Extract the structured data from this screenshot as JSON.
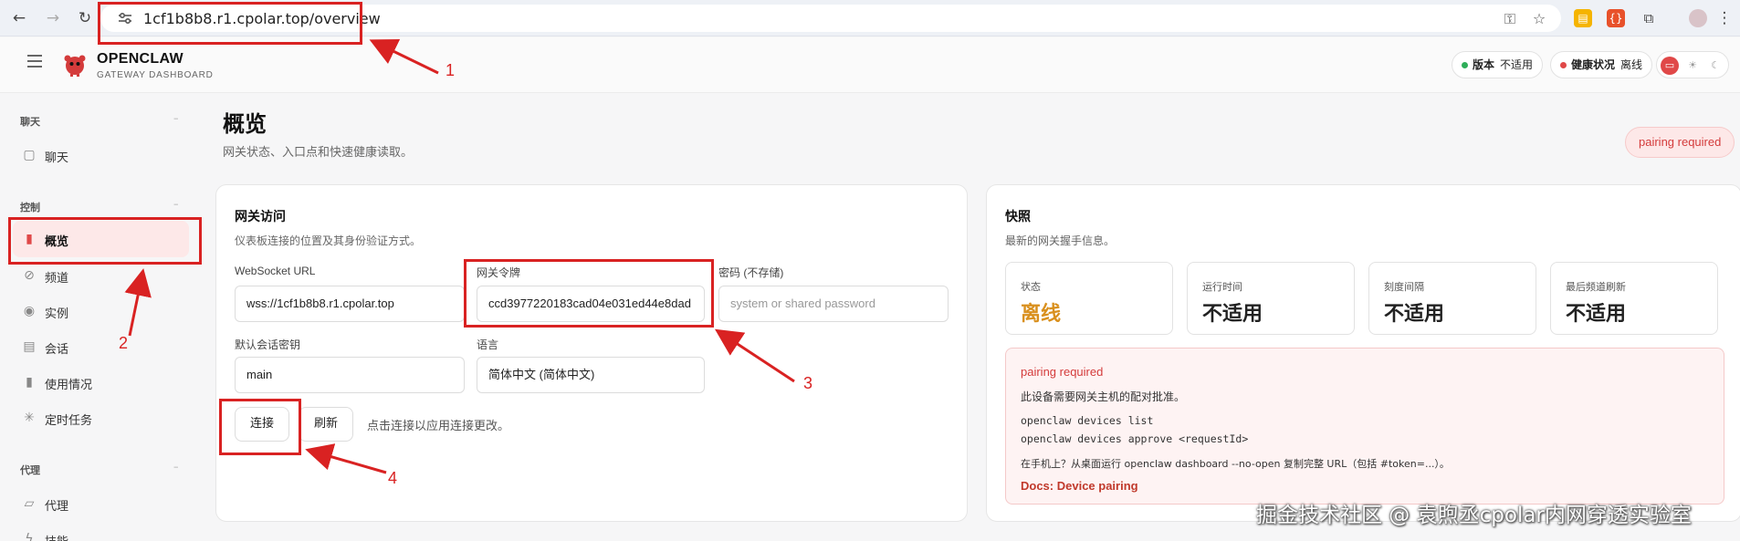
{
  "browser": {
    "url": "1cf1b8b8.r1.cpolar.top/overview"
  },
  "header": {
    "brand_name": "OPENCLAW",
    "brand_sub": "GATEWAY DASHBOARD",
    "version_label": "版本",
    "version_value": "不适用",
    "health_label": "健康状况",
    "health_value": "离线",
    "colors": {
      "accent": "#e04848",
      "ok": "#2fae5a",
      "danger": "#e04848"
    }
  },
  "sidebar": {
    "sections": [
      {
        "title": "聊天",
        "items": [
          {
            "label": "聊天",
            "icon": "chat-icon"
          }
        ]
      },
      {
        "title": "控制",
        "items": [
          {
            "label": "概览",
            "icon": "bar-chart-icon",
            "active": true
          },
          {
            "label": "频道",
            "icon": "link-icon"
          },
          {
            "label": "实例",
            "icon": "radio-icon"
          },
          {
            "label": "会话",
            "icon": "document-icon"
          },
          {
            "label": "使用情况",
            "icon": "bar-chart-icon"
          },
          {
            "label": "定时任务",
            "icon": "loader-icon"
          }
        ]
      },
      {
        "title": "代理",
        "items": [
          {
            "label": "代理",
            "icon": "folder-icon"
          },
          {
            "label": "技能",
            "icon": "zap-icon"
          }
        ]
      }
    ],
    "collapse_symbol": "–"
  },
  "main": {
    "title": "概览",
    "subtitle": "网关状态、入口点和快速健康读取。",
    "pairing_badge": "pairing required"
  },
  "gateway": {
    "title": "网关访问",
    "subtitle": "仪表板连接的位置及其身份验证方式。",
    "ws_label": "WebSocket URL",
    "ws_value": "wss://1cf1b8b8.r1.cpolar.top",
    "token_label": "网关令牌",
    "token_value": "ccd3977220183cad04e031ed44e8dad",
    "password_label": "密码 (不存储)",
    "password_placeholder": "system or shared password",
    "session_label": "默认会话密钥",
    "session_value": "main",
    "language_label": "语言",
    "language_value": "简体中文 (简体中文)",
    "connect_button": "连接",
    "refresh_button": "刷新",
    "hint": "点击连接以应用连接更改。"
  },
  "snapshot": {
    "title": "快照",
    "subtitle": "最新的网关握手信息。",
    "stats": [
      {
        "label": "状态",
        "value": "离线",
        "warn": true
      },
      {
        "label": "运行时间",
        "value": "不适用"
      },
      {
        "label": "刻度间隔",
        "value": "不适用"
      },
      {
        "label": "最后频道刷新",
        "value": "不适用"
      }
    ],
    "alert": {
      "title": "pairing required",
      "text": "此设备需要网关主机的配对批准。",
      "code_1": "openclaw devices list",
      "code_2": "openclaw devices approve <requestId>",
      "mobile_hint": "在手机上？从桌面运行 openclaw dashboard --no-open 复制完整 URL（包括 #token=...）。",
      "link": "Docs: Device pairing"
    }
  },
  "annotations": {
    "n1": "1",
    "n2": "2",
    "n3": "3",
    "n4": "4",
    "color": "#d92222"
  },
  "watermark": "掘金技术社区 @ 袁煦丞cpolar内网穿透实验室"
}
